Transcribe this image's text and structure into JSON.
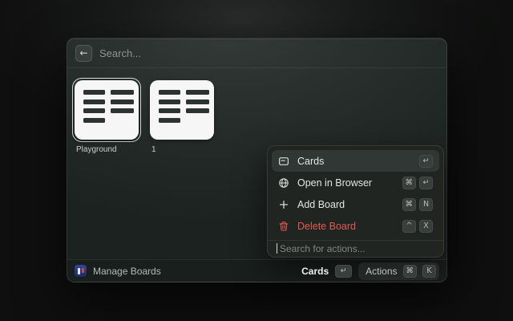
{
  "header": {
    "back_icon": "arrow-left",
    "search_placeholder": "Search..."
  },
  "boards": [
    {
      "name": "Playground",
      "selected": true
    },
    {
      "name": "1",
      "selected": false
    }
  ],
  "actions_menu": {
    "items": [
      {
        "label": "Cards",
        "icon": "card-icon",
        "keys": [
          "↵"
        ]
      },
      {
        "label": "Open in Browser",
        "icon": "globe-icon",
        "keys": [
          "⌘",
          "↵"
        ]
      },
      {
        "label": "Add Board",
        "icon": "plus-icon",
        "keys": [
          "⌘",
          "N"
        ]
      },
      {
        "label": "Delete Board",
        "icon": "trash-icon",
        "keys": [
          "^",
          "X"
        ]
      }
    ],
    "search_placeholder": "Search for actions..."
  },
  "footer": {
    "app_label": "Manage Boards",
    "primary_action": {
      "label": "Cards",
      "keys": [
        "↵"
      ]
    },
    "secondary_action": {
      "label": "Actions",
      "keys": [
        "⌘",
        "K"
      ]
    }
  },
  "colors": {
    "danger": "#e25a50",
    "selection_ring": "#dde0de",
    "thumbnail_bg": "#f5f6f5",
    "thumbnail_bar": "#2d3331",
    "menu_bg": "#202522",
    "selected_item_bg": "#313734"
  }
}
